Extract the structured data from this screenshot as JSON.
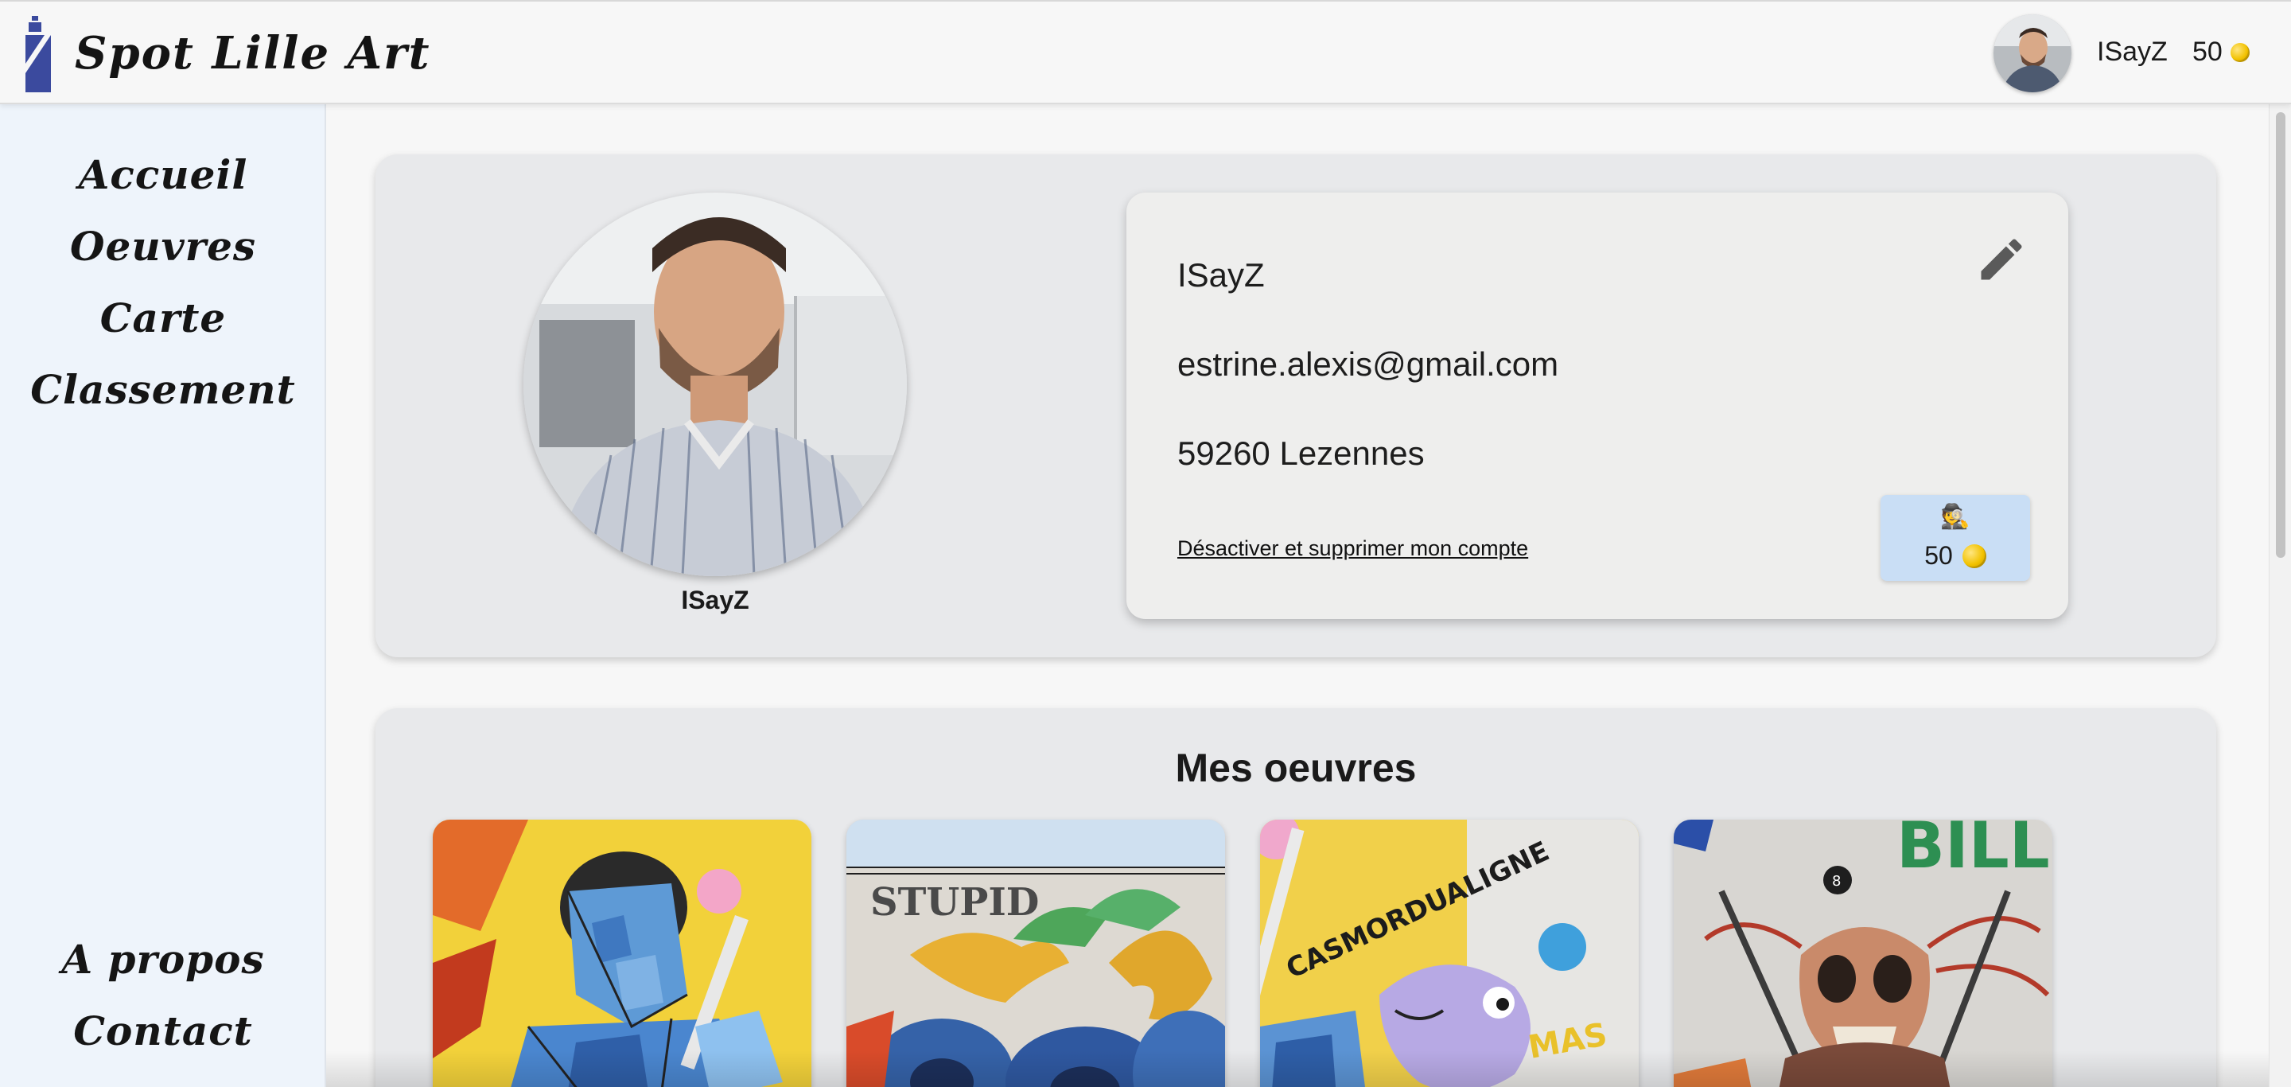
{
  "header": {
    "brand": "Spot Lille Art",
    "username": "ISayZ",
    "points": "50",
    "coin_icon": "coin-icon"
  },
  "sidebar": {
    "items": [
      {
        "label": "Accueil"
      },
      {
        "label": "Oeuvres"
      },
      {
        "label": "Carte"
      },
      {
        "label": "Classement"
      }
    ],
    "bottom_items": [
      {
        "label": "A propos"
      },
      {
        "label": "Contact"
      }
    ]
  },
  "profile": {
    "avatar_name": "ISayZ",
    "username": "ISayZ",
    "email": "estrine.alexis@gmail.com",
    "location": "59260 Lezennes",
    "delete_link": "Désactiver et supprimer mon compte",
    "badge": {
      "icon": "🕵",
      "points": "50"
    },
    "edit_icon": "pencil-icon"
  },
  "works": {
    "title": "Mes oeuvres",
    "items": [
      {
        "name": "artwork-1"
      },
      {
        "name": "artwork-2"
      },
      {
        "name": "artwork-3"
      },
      {
        "name": "artwork-4"
      }
    ]
  },
  "colors": {
    "sidebar_bg": "#eef4fb",
    "card_bg": "#e8e9eb",
    "badge_bg": "#c9def5",
    "logo_blue": "#3b4a9e"
  }
}
